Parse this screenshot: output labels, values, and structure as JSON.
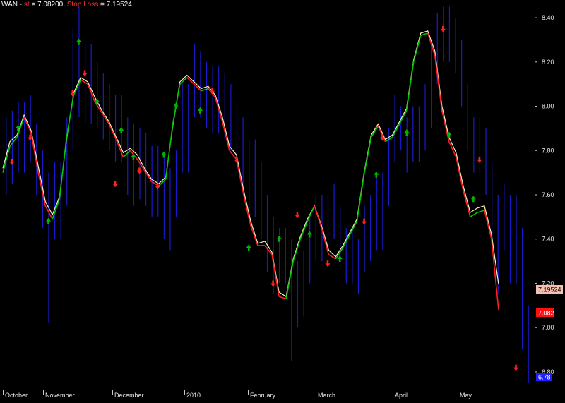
{
  "legend": {
    "symbol": "WAN",
    "dash": "-",
    "st_label": "st",
    "st_eq": "= 7.08200,",
    "sl_label": "Stop Loss",
    "sl_eq": "= 7.19524"
  },
  "badges": {
    "stop_loss": "7.19524",
    "st": "7.082",
    "last": "6.78"
  },
  "colors": {
    "background": "#000000",
    "bars": "#1a1acc",
    "st_line": "#ff2020",
    "st_line_bull": "#00c800",
    "stop_line": "#fff2c8",
    "buy_arrow": "#00b400",
    "sell_arrow": "#ff2020",
    "badge_stop": "#f4c0b0",
    "badge_st": "#ff1010",
    "badge_last": "#2020ff"
  },
  "chart_data": {
    "type": "line",
    "title": "",
    "ylim": [
      6.72,
      8.48
    ],
    "y_ticks": [
      "8.40",
      "8.20",
      "8.00",
      "7.80",
      "7.60",
      "7.40",
      "7.20",
      "7.00",
      "6.80"
    ],
    "x_ticks": [
      "October",
      "November",
      "December",
      "2010",
      "February",
      "March",
      "April",
      "May"
    ],
    "series": [
      {
        "name": "st",
        "values": [
          7.7,
          7.82,
          7.86,
          7.95,
          7.88,
          7.7,
          7.55,
          7.49,
          7.58,
          7.86,
          8.05,
          8.12,
          8.1,
          8.02,
          7.97,
          7.92,
          7.85,
          7.77,
          7.8,
          7.76,
          7.71,
          7.66,
          7.64,
          7.67,
          7.92,
          8.1,
          8.13,
          8.1,
          8.07,
          8.08,
          8.04,
          7.93,
          7.8,
          7.76,
          7.6,
          7.46,
          7.37,
          7.37,
          7.33,
          7.14,
          7.13,
          7.3,
          7.4,
          7.48,
          7.55,
          7.45,
          7.33,
          7.31,
          7.36,
          7.42,
          7.48,
          7.69,
          7.86,
          7.91,
          7.84,
          7.86,
          7.92,
          7.98,
          8.2,
          8.32,
          8.33,
          8.23,
          7.98,
          7.84,
          7.77,
          7.62,
          7.5,
          7.52,
          7.53,
          7.4,
          7.08
        ]
      },
      {
        "name": "Stop Loss",
        "values": [
          7.72,
          7.84,
          7.87,
          7.96,
          7.89,
          7.73,
          7.57,
          7.51,
          7.59,
          7.85,
          8.06,
          8.13,
          8.11,
          8.04,
          7.98,
          7.93,
          7.86,
          7.79,
          7.81,
          7.78,
          7.72,
          7.67,
          7.65,
          7.68,
          7.91,
          8.11,
          8.14,
          8.11,
          8.08,
          8.09,
          8.05,
          7.95,
          7.82,
          7.78,
          7.62,
          7.48,
          7.38,
          7.39,
          7.34,
          7.16,
          7.14,
          7.31,
          7.41,
          7.49,
          7.55,
          7.46,
          7.35,
          7.32,
          7.37,
          7.43,
          7.49,
          7.7,
          7.87,
          7.92,
          7.85,
          7.87,
          7.93,
          7.99,
          8.21,
          8.33,
          8.34,
          8.25,
          8.0,
          7.86,
          7.79,
          7.64,
          7.52,
          7.54,
          7.55,
          7.42,
          7.19524
        ]
      }
    ],
    "buy_signals": [
      {
        "bar": 2,
        "value": 7.9
      },
      {
        "bar": 7,
        "value": 7.48
      },
      {
        "bar": 12,
        "value": 8.29
      },
      {
        "bar": 15,
        "value": 8.02
      },
      {
        "bar": 19,
        "value": 7.89
      },
      {
        "bar": 21,
        "value": 7.77
      },
      {
        "bar": 26,
        "value": 7.78
      },
      {
        "bar": 28,
        "value": 8.0
      },
      {
        "bar": 32,
        "value": 7.98
      },
      {
        "bar": 40,
        "value": 7.36
      },
      {
        "bar": 45,
        "value": 7.4
      },
      {
        "bar": 50,
        "value": 7.42
      },
      {
        "bar": 55,
        "value": 7.31
      },
      {
        "bar": 61,
        "value": 7.69
      },
      {
        "bar": 66,
        "value": 7.88
      },
      {
        "bar": 73,
        "value": 7.87
      },
      {
        "bar": 77,
        "value": 7.58
      }
    ],
    "sell_signals": [
      {
        "bar": 1,
        "value": 7.75
      },
      {
        "bar": 4,
        "value": 7.86
      },
      {
        "bar": 11,
        "value": 8.06
      },
      {
        "bar": 13,
        "value": 8.15
      },
      {
        "bar": 18,
        "value": 7.65
      },
      {
        "bar": 22,
        "value": 7.71
      },
      {
        "bar": 25,
        "value": 7.64
      },
      {
        "bar": 34,
        "value": 8.07
      },
      {
        "bar": 38,
        "value": 7.76
      },
      {
        "bar": 44,
        "value": 7.2
      },
      {
        "bar": 48,
        "value": 7.51
      },
      {
        "bar": 53,
        "value": 7.29
      },
      {
        "bar": 59,
        "value": 7.48
      },
      {
        "bar": 62,
        "value": 7.86
      },
      {
        "bar": 72,
        "value": 8.35
      },
      {
        "bar": 78,
        "value": 7.76
      },
      {
        "bar": 84,
        "value": 6.82
      }
    ],
    "ohlc_ranges": [
      [
        7.6,
        7.95
      ],
      [
        7.65,
        7.98
      ],
      [
        7.7,
        8.02
      ],
      [
        7.75,
        8.05
      ],
      [
        7.6,
        7.92
      ],
      [
        7.45,
        7.8
      ],
      [
        7.02,
        7.7
      ],
      [
        7.4,
        7.75
      ],
      [
        7.55,
        7.95
      ],
      [
        7.8,
        8.35
      ],
      [
        7.95,
        8.45
      ],
      [
        7.92,
        8.28
      ],
      [
        7.9,
        8.2
      ],
      [
        7.85,
        8.15
      ],
      [
        7.8,
        8.1
      ],
      [
        7.75,
        8.05
      ],
      [
        7.6,
        7.95
      ],
      [
        7.55,
        7.92
      ],
      [
        7.58,
        7.9
      ],
      [
        7.55,
        7.88
      ],
      [
        7.5,
        7.82
      ],
      [
        7.4,
        7.78
      ],
      [
        7.35,
        7.72
      ],
      [
        7.5,
        7.8
      ],
      [
        7.7,
        8.1
      ],
      [
        7.95,
        8.28
      ],
      [
        7.95,
        8.25
      ],
      [
        7.9,
        8.2
      ],
      [
        7.88,
        8.18
      ],
      [
        7.85,
        8.15
      ],
      [
        7.8,
        8.1
      ],
      [
        7.7,
        8.02
      ],
      [
        7.6,
        7.95
      ],
      [
        7.5,
        7.85
      ],
      [
        7.4,
        7.75
      ],
      [
        7.25,
        7.6
      ],
      [
        7.15,
        7.5
      ],
      [
        7.2,
        7.45
      ],
      [
        6.85,
        7.4
      ],
      [
        7.0,
        7.3
      ],
      [
        7.05,
        7.35
      ],
      [
        7.2,
        7.5
      ],
      [
        7.3,
        7.6
      ],
      [
        7.35,
        7.6
      ],
      [
        7.4,
        7.65
      ],
      [
        7.3,
        7.55
      ],
      [
        7.2,
        7.45
      ],
      [
        7.15,
        7.4
      ],
      [
        7.25,
        7.55
      ],
      [
        7.3,
        7.6
      ],
      [
        7.35,
        7.7
      ],
      [
        7.55,
        7.9
      ],
      [
        7.75,
        8.05
      ],
      [
        7.8,
        8.0
      ],
      [
        7.7,
        7.95
      ],
      [
        7.75,
        8.0
      ],
      [
        7.8,
        8.1
      ],
      [
        7.9,
        8.3
      ],
      [
        8.1,
        8.42
      ],
      [
        8.2,
        8.45
      ],
      [
        8.15,
        8.4
      ],
      [
        8.0,
        8.3
      ],
      [
        7.8,
        8.1
      ],
      [
        7.7,
        7.95
      ],
      [
        7.6,
        7.9
      ],
      [
        7.4,
        7.75
      ],
      [
        7.15,
        7.6
      ],
      [
        7.35,
        7.65
      ],
      [
        7.2,
        7.6
      ],
      [
        6.9,
        7.45
      ],
      [
        6.75,
        7.1
      ]
    ]
  }
}
